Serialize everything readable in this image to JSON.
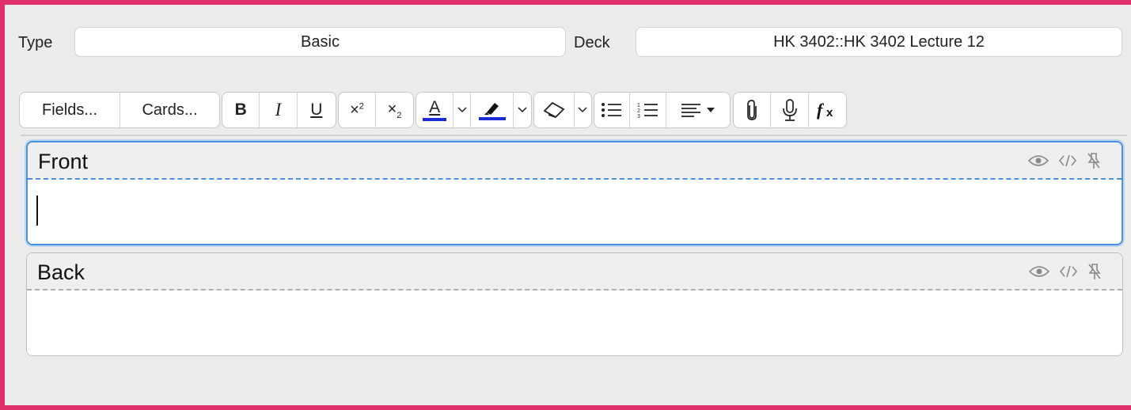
{
  "type": {
    "label": "Type",
    "value": "Basic"
  },
  "deck": {
    "label": "Deck",
    "value": "HK 3402::HK 3402 Lecture 12"
  },
  "toolbar": {
    "fields_label": "Fields...",
    "cards_label": "Cards...",
    "bold": "B",
    "italic": "I",
    "underline": "U",
    "text_color_letter": "A",
    "icon_color": "#1b2bd6"
  },
  "fields": [
    {
      "name": "Front",
      "focused": true,
      "value": ""
    },
    {
      "name": "Back",
      "focused": false,
      "value": ""
    }
  ],
  "colors": {
    "frame": "#e0306a",
    "focus_border": "#4a90e2",
    "text_color_bar": "#1b2bd6"
  }
}
